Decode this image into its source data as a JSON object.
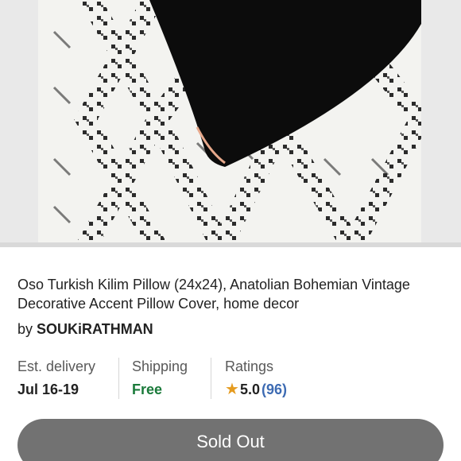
{
  "listing": {
    "title": "Oso Turkish Kilim Pillow (24x24), Anatolian Bohemian Vintage Decorative Accent Pillow Cover, home decor",
    "seller_prefix": "by",
    "seller_name": "SOUKiRATHMAN"
  },
  "stats": {
    "delivery_label": "Est. delivery",
    "delivery_value": "Jul 16-19",
    "shipping_label": "Shipping",
    "shipping_value": "Free",
    "ratings_label": "Ratings",
    "rating_value": "5.0",
    "rating_count": "(96)",
    "star_icon": "★"
  },
  "action": {
    "button_label": "Sold Out"
  },
  "colors": {
    "free_shipping": "#1a7a3a",
    "rating_count": "#3d6bb3",
    "star": "#e59b1f",
    "button": "#727272"
  }
}
